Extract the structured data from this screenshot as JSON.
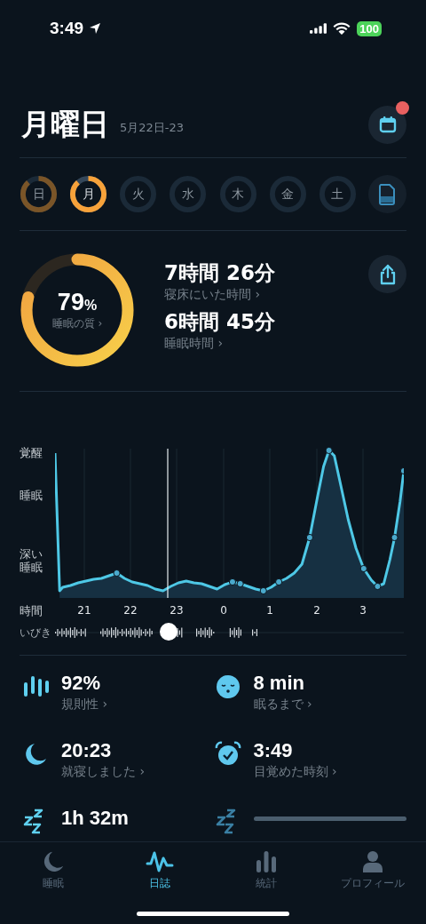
{
  "status_bar": {
    "time": "3:49",
    "battery": "100"
  },
  "header": {
    "title": "月曜日",
    "date_range": "5月22日-23",
    "calendar_badge": true
  },
  "days": [
    {
      "label": "日",
      "recorded": true,
      "selected": false
    },
    {
      "label": "月",
      "recorded": true,
      "selected": true
    },
    {
      "label": "火",
      "recorded": false,
      "selected": false
    },
    {
      "label": "水",
      "recorded": false,
      "selected": false
    },
    {
      "label": "木",
      "recorded": false,
      "selected": false
    },
    {
      "label": "金",
      "recorded": false,
      "selected": false
    },
    {
      "label": "土",
      "recorded": false,
      "selected": false
    }
  ],
  "summary": {
    "quality": {
      "value": "79",
      "unit": "%",
      "label": "睡眠の質 ›"
    },
    "metrics": [
      {
        "value": "7時間 26分",
        "label": "寝床にいた時間 ›"
      },
      {
        "value": "6時間 45分",
        "label": "睡眠時間 ›"
      }
    ]
  },
  "hypnogram": {
    "stages": [
      "覚醒",
      "睡眠",
      "深い睡眠"
    ],
    "time_label": "時間",
    "hours": [
      "21",
      "22",
      "23",
      "0",
      "1",
      "2",
      "3"
    ],
    "snore_label": "いびき"
  },
  "stats": [
    {
      "kind": "value",
      "value": "92%",
      "label": "規則性 ›"
    },
    {
      "kind": "value",
      "value": "8 min",
      "label": "眠るまで ›"
    },
    {
      "kind": "value",
      "value": "20:23",
      "label": "就寝しました ›"
    },
    {
      "kind": "value",
      "value": "3:49",
      "label": "目覚めた時刻 ›"
    },
    {
      "kind": "value",
      "value": "1h 32m"
    },
    {
      "kind": "loading"
    }
  ],
  "tab_bar": [
    {
      "label": "睡眠",
      "selected": false
    },
    {
      "label": "日誌",
      "selected": true
    },
    {
      "label": "統計",
      "selected": false
    },
    {
      "label": "プロフィール",
      "selected": false
    }
  ]
}
